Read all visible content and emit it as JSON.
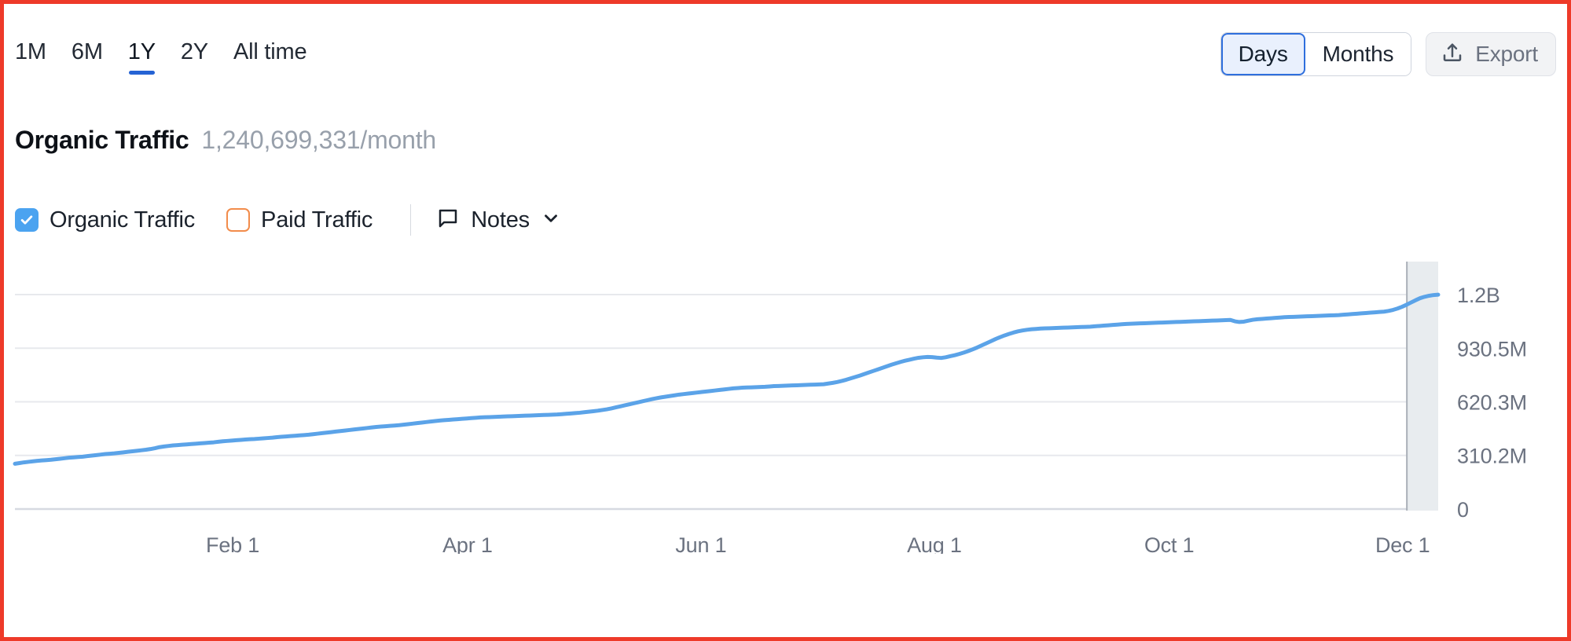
{
  "toolbar": {
    "ranges": [
      {
        "label": "1M",
        "active": false
      },
      {
        "label": "6M",
        "active": false
      },
      {
        "label": "1Y",
        "active": true
      },
      {
        "label": "2Y",
        "active": false
      },
      {
        "label": "All time",
        "active": false
      }
    ],
    "granularity": {
      "options": [
        "Days",
        "Months"
      ],
      "selected": "Days",
      "days_label": "Days",
      "months_label": "Months"
    },
    "export_label": "Export",
    "export_icon": "upload-icon"
  },
  "header": {
    "metric_title": "Organic Traffic",
    "metric_value": "1,240,699,331/month"
  },
  "legend": {
    "organic": {
      "label": "Organic Traffic",
      "checked": true,
      "color": "#4ba3f0"
    },
    "paid": {
      "label": "Paid Traffic",
      "checked": false,
      "color": "#f28c4b"
    },
    "notes": {
      "label": "Notes",
      "icon": "note-bubble-icon",
      "chevron": "chevron-down-icon"
    }
  },
  "chart_data": {
    "type": "line",
    "title": "Organic Traffic",
    "xlabel": "",
    "ylabel": "",
    "grid": true,
    "legend_position": "top-left",
    "series": [
      {
        "name": "Organic Traffic",
        "color": "#5ba3e8",
        "values": [
          262,
          266,
          270,
          273,
          276,
          279,
          281,
          283,
          285,
          288,
          291,
          294,
          297,
          299,
          301,
          303,
          306,
          309,
          312,
          315,
          318,
          320,
          322,
          325,
          328,
          331,
          334,
          337,
          340,
          343,
          347,
          352,
          358,
          362,
          365,
          368,
          370,
          372,
          374,
          376,
          378,
          380,
          382,
          384,
          386,
          389,
          392,
          394,
          396,
          398,
          400,
          402,
          404,
          405,
          407,
          409,
          411,
          413,
          416,
          418,
          420,
          422,
          424,
          426,
          428,
          430,
          433,
          436,
          439,
          442,
          445,
          448,
          451,
          454,
          457,
          460,
          463,
          466,
          469,
          472,
          475,
          477,
          479,
          481,
          483,
          485,
          488,
          491,
          494,
          497,
          500,
          503,
          506,
          509,
          512,
          514,
          516,
          518,
          520,
          522,
          524,
          526,
          528,
          530,
          531,
          532,
          533,
          534,
          535,
          536,
          537,
          538,
          539,
          540,
          541,
          542,
          543,
          544,
          545,
          546,
          547,
          549,
          551,
          553,
          555,
          557,
          560,
          563,
          566,
          569,
          573,
          577,
          582,
          588,
          594,
          600,
          606,
          612,
          618,
          624,
          630,
          636,
          641,
          646,
          650,
          654,
          658,
          662,
          665,
          668,
          671,
          674,
          677,
          680,
          683,
          686,
          689,
          692,
          695,
          698,
          700,
          702,
          703,
          704,
          705,
          706,
          707,
          709,
          711,
          712,
          713,
          714,
          715,
          716,
          717,
          718,
          719,
          720,
          721,
          722,
          726,
          730,
          735,
          741,
          748,
          756,
          764,
          772,
          781,
          790,
          799,
          808,
          817,
          826,
          835,
          843,
          851,
          858,
          864,
          870,
          875,
          878,
          880,
          879,
          876,
          874,
          878,
          884,
          890,
          897,
          905,
          914,
          924,
          935,
          947,
          959,
          971,
          983,
          994,
          1004,
          1013,
          1021,
          1028,
          1033,
          1037,
          1040,
          1042,
          1044,
          1045,
          1046,
          1047,
          1048,
          1049,
          1050,
          1051,
          1052,
          1053,
          1054,
          1055,
          1057,
          1059,
          1061,
          1063,
          1065,
          1067,
          1069,
          1071,
          1072,
          1073,
          1074,
          1075,
          1076,
          1077,
          1078,
          1079,
          1080,
          1081,
          1082,
          1083,
          1084,
          1085,
          1086,
          1087,
          1088,
          1089,
          1090,
          1091,
          1092,
          1093,
          1094,
          1086,
          1082,
          1084,
          1090,
          1095,
          1098,
          1100,
          1102,
          1104,
          1106,
          1108,
          1110,
          1111,
          1112,
          1113,
          1114,
          1115,
          1116,
          1117,
          1118,
          1119,
          1120,
          1121,
          1122,
          1124,
          1126,
          1128,
          1130,
          1132,
          1134,
          1136,
          1138,
          1140,
          1142,
          1146,
          1152,
          1160,
          1170,
          1182,
          1195,
          1208,
          1220,
          1228,
          1234,
          1238,
          1240
        ]
      }
    ],
    "y_ticks": [
      {
        "label": "0",
        "value": 0
      },
      {
        "label": "310.2M",
        "value": 310.2
      },
      {
        "label": "620.3M",
        "value": 620.3
      },
      {
        "label": "930.5M",
        "value": 930.5
      },
      {
        "label": "1.2B",
        "value": 1240.7
      }
    ],
    "x_ticks": [
      "Feb 1",
      "Apr 1",
      "Jun 1",
      "Aug 1",
      "Oct 1",
      "Dec 1"
    ],
    "x_tick_positions": [
      0.153,
      0.318,
      0.482,
      0.646,
      0.811,
      0.975
    ],
    "ylim": [
      0,
      1240.7
    ],
    "value_unit": "millions",
    "highlight_band": {
      "start": 0.978,
      "end": 1.0
    }
  },
  "colors": {
    "frame_border": "#ee3a29",
    "line": "#5ba3e8",
    "accent_blue": "#2563d4",
    "grid": "#e7e9ed"
  }
}
